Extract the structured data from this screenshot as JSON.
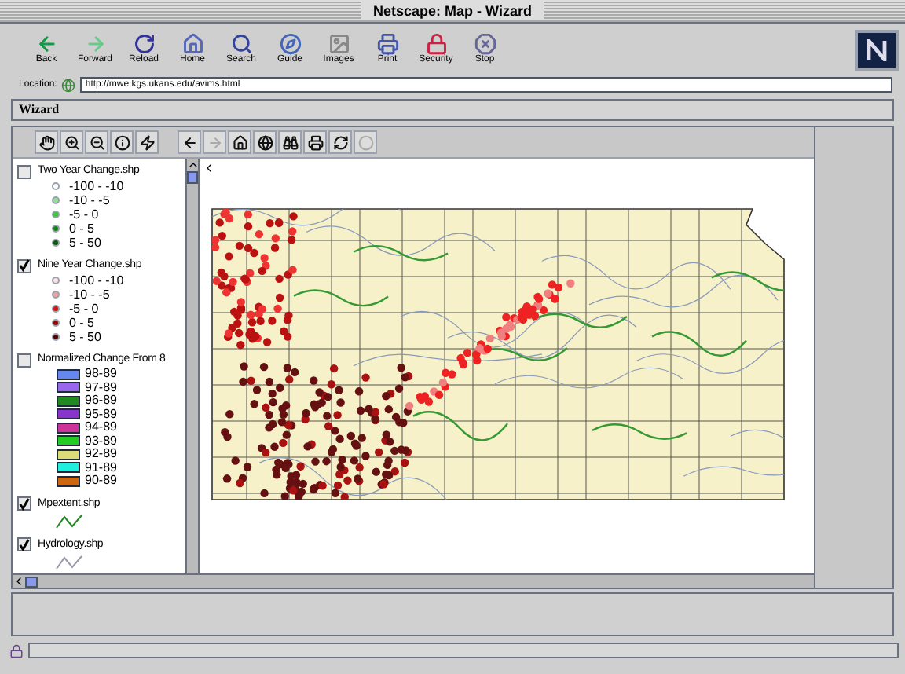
{
  "window": {
    "title": "Netscape: Map - Wizard"
  },
  "toolbar": [
    {
      "label": "Back"
    },
    {
      "label": "Forward"
    },
    {
      "label": "Reload"
    },
    {
      "label": "Home"
    },
    {
      "label": "Search"
    },
    {
      "label": "Guide"
    },
    {
      "label": "Images"
    },
    {
      "label": "Print"
    },
    {
      "label": "Security"
    },
    {
      "label": "Stop"
    }
  ],
  "location": {
    "label": "Location:",
    "value": "http://mwe.kgs.ukans.edu/avims.html"
  },
  "frame_title": "Wizard",
  "layers": [
    {
      "name": "Two Year Change.shp",
      "checked": false,
      "kind": "points",
      "classes": [
        {
          "label": "-100 - -10",
          "color": "#ffffff"
        },
        {
          "label": "-10 - -5",
          "color": "#99dd99"
        },
        {
          "label": "-5 - 0",
          "color": "#33cc33"
        },
        {
          "label": "0 - 5",
          "color": "#118811"
        },
        {
          "label": "5 - 50",
          "color": "#0a5a0a"
        }
      ]
    },
    {
      "name": "Nine Year Change.shp",
      "checked": true,
      "kind": "points",
      "classes": [
        {
          "label": "-100 - -10",
          "color": "#ffe0e0"
        },
        {
          "label": "-10 - -5",
          "color": "#f0a0a0"
        },
        {
          "label": "-5 - 0",
          "color": "#dd1111"
        },
        {
          "label": "0 - 5",
          "color": "#990000"
        },
        {
          "label": "5 - 50",
          "color": "#550000"
        }
      ]
    },
    {
      "name": "Normalized Change From 8",
      "checked": false,
      "kind": "fills",
      "classes": [
        {
          "label": "98-89",
          "color": "#6688ee"
        },
        {
          "label": "97-89",
          "color": "#9966ee"
        },
        {
          "label": "96-89",
          "color": "#228822"
        },
        {
          "label": "95-89",
          "color": "#8833cc"
        },
        {
          "label": "94-89",
          "color": "#cc3399"
        },
        {
          "label": "93-89",
          "color": "#22cc22"
        },
        {
          "label": "92-89",
          "color": "#dddd77"
        },
        {
          "label": "91-89",
          "color": "#22eedd"
        },
        {
          "label": "90-89",
          "color": "#cc6611"
        }
      ]
    },
    {
      "name": "Mpextent.shp",
      "checked": true,
      "kind": "line",
      "color": "#228822"
    },
    {
      "name": "Hydrology.shp",
      "checked": true,
      "kind": "line",
      "color": "#9999aa"
    }
  ]
}
